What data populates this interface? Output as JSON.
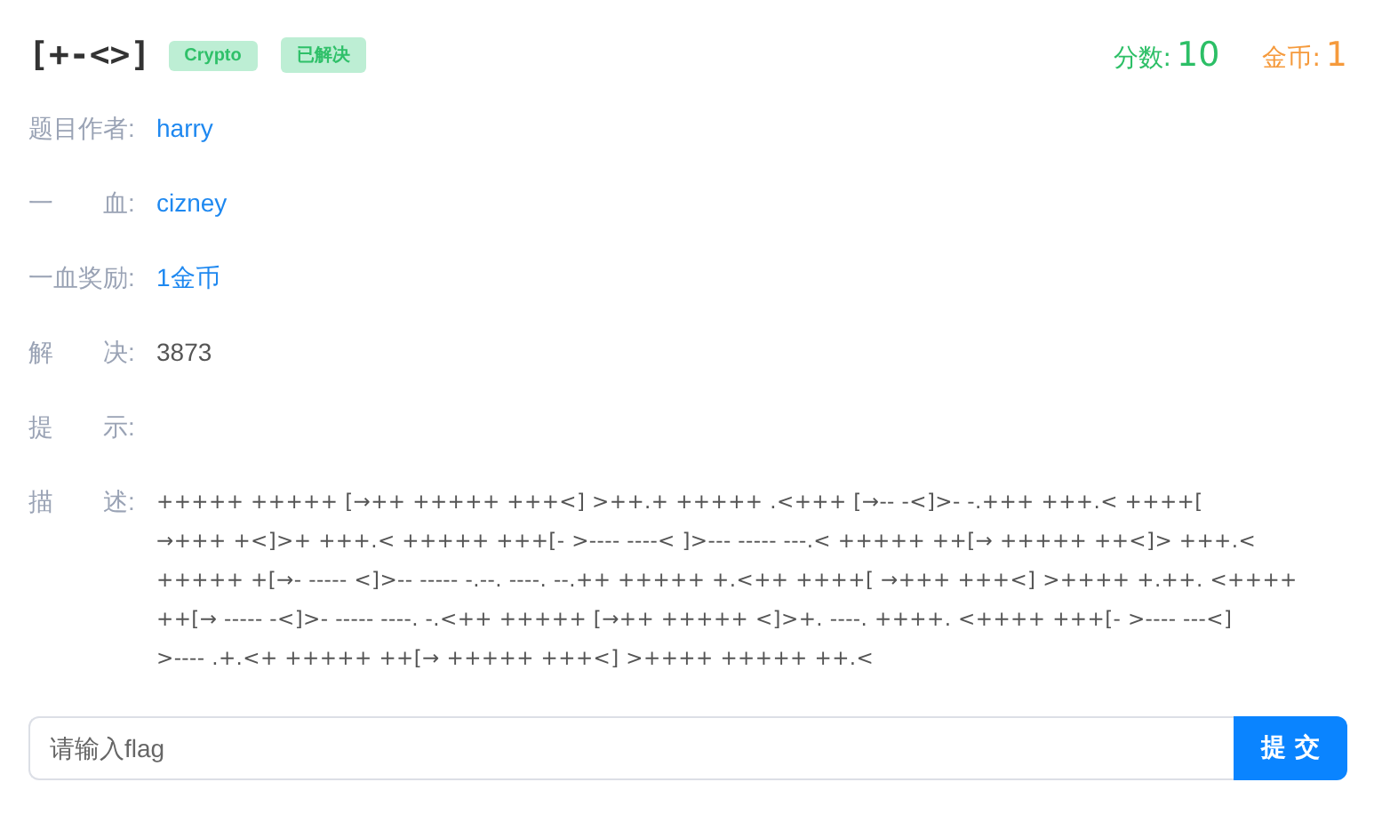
{
  "title": "[+-<>]",
  "tags": [
    {
      "label": "Crypto"
    },
    {
      "label": "已解决"
    }
  ],
  "score": {
    "label": "分数:",
    "value": "10"
  },
  "coins": {
    "label": "金币:",
    "value": "1"
  },
  "fields": [
    {
      "label": "题目作者:",
      "value": "harry",
      "kind": "link"
    },
    {
      "label": "一　　血:",
      "value": "cizney",
      "kind": "link"
    },
    {
      "label": "一血奖励:",
      "value": "1金币",
      "kind": "link"
    },
    {
      "label": "解　　决:",
      "value": "3873",
      "kind": "text"
    },
    {
      "label": "提　　示:"
    }
  ],
  "description": {
    "label": "描　　述:",
    "lines": [
      "+++++ +++++ [→++ +++++ +++<] >++.+ +++++ .<+++ [→-- -<]>- -.+++ +++.< ++++[",
      "→+++ +<]>+ +++.< +++++ +++[- >---- ----< ]>--- ----- ---.< +++++ ++[→ +++++ ++<]> +++.<",
      "+++++ +[→- ----- <]>-- ----- -.--. ----. --.++ +++++ +.<++ ++++[ →+++ +++<] >++++ +.++. <++++",
      "++[→ ----- -<]>- ----- ----. -.<++ +++++ [→++ +++++ <]>+. ----. ++++. <++++ +++[- >---- ---<]",
      ">---- .+.<+ +++++ ++[→ +++++ +++<] >++++ +++++ ++.<"
    ]
  },
  "flag_input": {
    "placeholder": "请输入flag"
  },
  "submit_button": "提 交"
}
